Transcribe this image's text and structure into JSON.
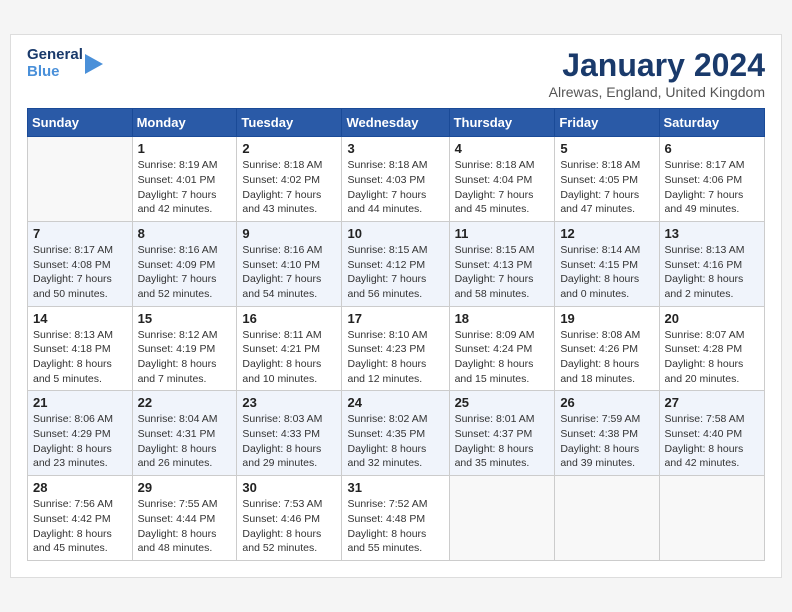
{
  "header": {
    "logo": {
      "general": "General",
      "blue": "Blue",
      "icon": "▶"
    },
    "title": "January 2024",
    "location": "Alrewas, England, United Kingdom"
  },
  "days_of_week": [
    "Sunday",
    "Monday",
    "Tuesday",
    "Wednesday",
    "Thursday",
    "Friday",
    "Saturday"
  ],
  "weeks": [
    [
      {
        "day": "",
        "info": ""
      },
      {
        "day": "1",
        "info": "Sunrise: 8:19 AM\nSunset: 4:01 PM\nDaylight: 7 hours\nand 42 minutes."
      },
      {
        "day": "2",
        "info": "Sunrise: 8:18 AM\nSunset: 4:02 PM\nDaylight: 7 hours\nand 43 minutes."
      },
      {
        "day": "3",
        "info": "Sunrise: 8:18 AM\nSunset: 4:03 PM\nDaylight: 7 hours\nand 44 minutes."
      },
      {
        "day": "4",
        "info": "Sunrise: 8:18 AM\nSunset: 4:04 PM\nDaylight: 7 hours\nand 45 minutes."
      },
      {
        "day": "5",
        "info": "Sunrise: 8:18 AM\nSunset: 4:05 PM\nDaylight: 7 hours\nand 47 minutes."
      },
      {
        "day": "6",
        "info": "Sunrise: 8:17 AM\nSunset: 4:06 PM\nDaylight: 7 hours\nand 49 minutes."
      }
    ],
    [
      {
        "day": "7",
        "info": "Sunrise: 8:17 AM\nSunset: 4:08 PM\nDaylight: 7 hours\nand 50 minutes."
      },
      {
        "day": "8",
        "info": "Sunrise: 8:16 AM\nSunset: 4:09 PM\nDaylight: 7 hours\nand 52 minutes."
      },
      {
        "day": "9",
        "info": "Sunrise: 8:16 AM\nSunset: 4:10 PM\nDaylight: 7 hours\nand 54 minutes."
      },
      {
        "day": "10",
        "info": "Sunrise: 8:15 AM\nSunset: 4:12 PM\nDaylight: 7 hours\nand 56 minutes."
      },
      {
        "day": "11",
        "info": "Sunrise: 8:15 AM\nSunset: 4:13 PM\nDaylight: 7 hours\nand 58 minutes."
      },
      {
        "day": "12",
        "info": "Sunrise: 8:14 AM\nSunset: 4:15 PM\nDaylight: 8 hours\nand 0 minutes."
      },
      {
        "day": "13",
        "info": "Sunrise: 8:13 AM\nSunset: 4:16 PM\nDaylight: 8 hours\nand 2 minutes."
      }
    ],
    [
      {
        "day": "14",
        "info": "Sunrise: 8:13 AM\nSunset: 4:18 PM\nDaylight: 8 hours\nand 5 minutes."
      },
      {
        "day": "15",
        "info": "Sunrise: 8:12 AM\nSunset: 4:19 PM\nDaylight: 8 hours\nand 7 minutes."
      },
      {
        "day": "16",
        "info": "Sunrise: 8:11 AM\nSunset: 4:21 PM\nDaylight: 8 hours\nand 10 minutes."
      },
      {
        "day": "17",
        "info": "Sunrise: 8:10 AM\nSunset: 4:23 PM\nDaylight: 8 hours\nand 12 minutes."
      },
      {
        "day": "18",
        "info": "Sunrise: 8:09 AM\nSunset: 4:24 PM\nDaylight: 8 hours\nand 15 minutes."
      },
      {
        "day": "19",
        "info": "Sunrise: 8:08 AM\nSunset: 4:26 PM\nDaylight: 8 hours\nand 18 minutes."
      },
      {
        "day": "20",
        "info": "Sunrise: 8:07 AM\nSunset: 4:28 PM\nDaylight: 8 hours\nand 20 minutes."
      }
    ],
    [
      {
        "day": "21",
        "info": "Sunrise: 8:06 AM\nSunset: 4:29 PM\nDaylight: 8 hours\nand 23 minutes."
      },
      {
        "day": "22",
        "info": "Sunrise: 8:04 AM\nSunset: 4:31 PM\nDaylight: 8 hours\nand 26 minutes."
      },
      {
        "day": "23",
        "info": "Sunrise: 8:03 AM\nSunset: 4:33 PM\nDaylight: 8 hours\nand 29 minutes."
      },
      {
        "day": "24",
        "info": "Sunrise: 8:02 AM\nSunset: 4:35 PM\nDaylight: 8 hours\nand 32 minutes."
      },
      {
        "day": "25",
        "info": "Sunrise: 8:01 AM\nSunset: 4:37 PM\nDaylight: 8 hours\nand 35 minutes."
      },
      {
        "day": "26",
        "info": "Sunrise: 7:59 AM\nSunset: 4:38 PM\nDaylight: 8 hours\nand 39 minutes."
      },
      {
        "day": "27",
        "info": "Sunrise: 7:58 AM\nSunset: 4:40 PM\nDaylight: 8 hours\nand 42 minutes."
      }
    ],
    [
      {
        "day": "28",
        "info": "Sunrise: 7:56 AM\nSunset: 4:42 PM\nDaylight: 8 hours\nand 45 minutes."
      },
      {
        "day": "29",
        "info": "Sunrise: 7:55 AM\nSunset: 4:44 PM\nDaylight: 8 hours\nand 48 minutes."
      },
      {
        "day": "30",
        "info": "Sunrise: 7:53 AM\nSunset: 4:46 PM\nDaylight: 8 hours\nand 52 minutes."
      },
      {
        "day": "31",
        "info": "Sunrise: 7:52 AM\nSunset: 4:48 PM\nDaylight: 8 hours\nand 55 minutes."
      },
      {
        "day": "",
        "info": ""
      },
      {
        "day": "",
        "info": ""
      },
      {
        "day": "",
        "info": ""
      }
    ]
  ]
}
